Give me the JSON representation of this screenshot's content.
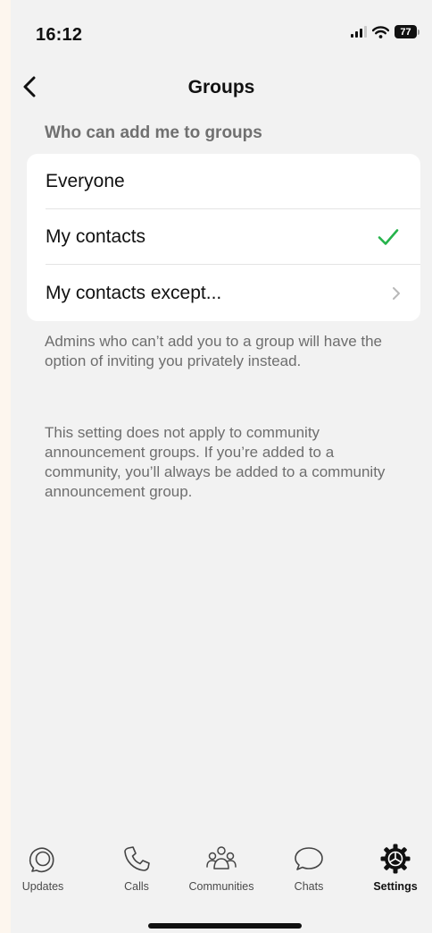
{
  "status_bar": {
    "time": "16:12",
    "battery": "77"
  },
  "nav": {
    "title": "Groups"
  },
  "section": {
    "header": "Who can add me to groups",
    "options": [
      {
        "label": "Everyone",
        "selected": false,
        "has_chevron": false
      },
      {
        "label": "My contacts",
        "selected": true,
        "has_chevron": false
      },
      {
        "label": "My contacts except...",
        "selected": false,
        "has_chevron": true
      }
    ],
    "footer_1": "Admins who can’t add you to a group will have the option of inviting you privately instead.",
    "footer_2": "This setting does not apply to community announcement groups. If you’re added to a community, you’ll always be added to a community announcement group."
  },
  "tabs": [
    {
      "label": "Updates",
      "icon": "updates-icon",
      "active": false
    },
    {
      "label": "Calls",
      "icon": "phone-icon",
      "active": false
    },
    {
      "label": "Communities",
      "icon": "communities-icon",
      "active": false
    },
    {
      "label": "Chats",
      "icon": "chats-icon",
      "active": false
    },
    {
      "label": "Settings",
      "icon": "gear-icon",
      "active": true
    }
  ],
  "colors": {
    "accent_green": "#25b34b",
    "background": "#f2f2f2",
    "secondary_text": "#6e6e6e"
  }
}
